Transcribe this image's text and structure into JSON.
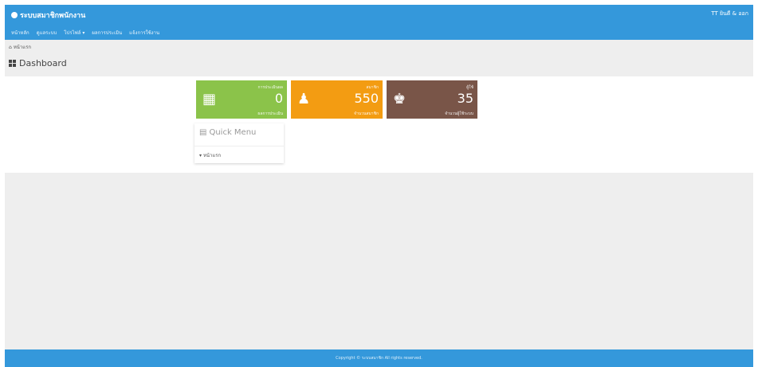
{
  "header": {
    "brand": "ระบบสมาชิกพนักงาน",
    "user_text": "TT ยินดี & ออก"
  },
  "nav": [
    "หน้าหลัก",
    "ดูแลระบบ",
    "โปรไฟล์ ▾",
    "ผลการประเมิน",
    "แจ้งการใช้งาน"
  ],
  "breadcrumb": "หน้าแรก",
  "page_title": "Dashboard",
  "tiles": [
    {
      "label": "การประเมินผล",
      "value": "0",
      "sub": "ผลการประเมิน",
      "color": "#8bc34a",
      "icon": "building-icon"
    },
    {
      "label": "สมาชิก",
      "value": "550",
      "sub": "จำนวนสมาชิก",
      "color": "#f39c12",
      "icon": "user-icon"
    },
    {
      "label": "ผู้ใช้",
      "value": "35",
      "sub": "จำนวนผู้ใช้ระบบ",
      "color": "#795548",
      "icon": "user-tie-icon"
    }
  ],
  "quick_menu": {
    "title": "Quick Menu",
    "item": "หน้าแรก"
  },
  "footer": "Copyright © ระบบสมาชิก All rights reserved."
}
